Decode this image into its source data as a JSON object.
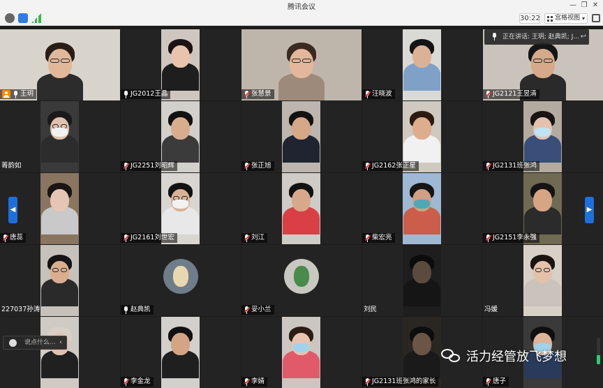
{
  "window": {
    "title": "腾讯会议"
  },
  "toolbar": {
    "icons": [
      "info-icon",
      "shield-icon",
      "signal-icon"
    ],
    "timer": "30:22",
    "view_mode": "宫格视图",
    "fullscreen_icon": "fullscreen-icon"
  },
  "speaking_banner": {
    "text": "正在讲话: 王玥; 赵典凯; J..."
  },
  "chat": {
    "placeholder": "说点什么..."
  },
  "watermark": {
    "text": "活力经管放飞梦想"
  },
  "volume": {
    "level": 0.35
  },
  "participants": [
    {
      "name": "王玥",
      "mic": "on",
      "host": true,
      "kind": "video",
      "bg": "#d8d4cc",
      "skin": "#e2b89a",
      "hair": "#2a1d16",
      "shirt": "#2c2c2c",
      "glasses": true,
      "mask": false
    },
    {
      "name": "JG2012王晶",
      "mic": "on",
      "kind": "video",
      "bg": "#cfc6c0",
      "skin": "#e8c4ad",
      "hair": "#1b1412",
      "shirt": "#1e1e1e",
      "glasses": false,
      "mask": false
    },
    {
      "name": "张慧景",
      "mic": "off",
      "kind": "video",
      "bg": "#bfb6ab",
      "skin": "#e3b79b",
      "hair": "#3a2a20",
      "shirt": "#9e8a7a",
      "glasses": true,
      "mask": false
    },
    {
      "name": "汪晓波",
      "mic": "off",
      "kind": "video",
      "bg": "#d9dad6",
      "skin": "#dcb296",
      "hair": "#141414",
      "shirt": "#7fa1c8",
      "glasses": false,
      "mask": false
    },
    {
      "name": "JG2121王昱清",
      "mic": "off",
      "kind": "video",
      "bg": "#c9c3bb",
      "skin": "#d6a98a",
      "hair": "#151515",
      "shirt": "#2a2a2a",
      "glasses": true,
      "mask": false
    },
    {
      "name": "菁韵如",
      "mic": "none",
      "kind": "video",
      "bg": "#3a3a3a",
      "skin": "#e0c0ae",
      "hair": "#1a1a1a",
      "shirt": "#2c2c2c",
      "glasses": true,
      "mask": true,
      "mask_color": "#f1f1f1"
    },
    {
      "name": "JG2251刘昭辉",
      "mic": "off",
      "kind": "video",
      "bg": "#d2d0cb",
      "skin": "#d8ad8e",
      "hair": "#111111",
      "shirt": "#3b3b3b",
      "glasses": false,
      "mask": false
    },
    {
      "name": "张正旭",
      "mic": "off",
      "kind": "video",
      "bg": "#bcb6ae",
      "skin": "#d6a887",
      "hair": "#121212",
      "shirt": "#1f2430",
      "glasses": false,
      "mask": false
    },
    {
      "name": "JG2162张正星",
      "mic": "off",
      "kind": "video",
      "bg": "#cfc9bf",
      "skin": "#dcae8e",
      "hair": "#2b1a10",
      "shirt": "#f1f1f1",
      "glasses": false,
      "mask": false
    },
    {
      "name": "JG2131班张鸿",
      "mic": "off",
      "kind": "video",
      "bg": "#b3aba0",
      "skin": "#e4c2ad",
      "hair": "#1a1412",
      "shirt": "#3a4e7a",
      "glasses": false,
      "mask": true,
      "mask_color": "#bfe3f2"
    },
    {
      "name": "唐蕊",
      "mic": "off",
      "kind": "video",
      "bg": "#8a7560",
      "skin": "#e5c6b5",
      "hair": "#1a1512",
      "shirt": "#c9c9c9",
      "glasses": false,
      "mask": false
    },
    {
      "name": "JG2161刘世宏",
      "mic": "off",
      "kind": "video",
      "bg": "#d9d6d1",
      "skin": "#d9b296",
      "hair": "#121212",
      "shirt": "#e8e8e8",
      "glasses": true,
      "mask": true,
      "mask_color": "#f2f2f2"
    },
    {
      "name": "刘江",
      "mic": "off",
      "kind": "video",
      "bg": "#cfccc7",
      "skin": "#d7a98a",
      "hair": "#121212",
      "shirt": "#d94046",
      "glasses": false,
      "mask": false
    },
    {
      "name": "柴宏亮",
      "mic": "off",
      "kind": "video",
      "bg": "#9fb9d4",
      "skin": "#cfa084",
      "hair": "#161616",
      "shirt": "#cc5d4b",
      "glasses": false,
      "mask": true,
      "mask_color": "#4fa8b8"
    },
    {
      "name": "JG2151李永强",
      "mic": "off",
      "kind": "video",
      "bg": "#6f6a52",
      "skin": "#d6a583",
      "hair": "#141414",
      "shirt": "#2b2b2b",
      "glasses": false,
      "mask": false
    },
    {
      "name": "227037孙涛",
      "mic": "none",
      "kind": "video",
      "bg": "#c6c1ba",
      "skin": "#d9ae90",
      "hair": "#141414",
      "shirt": "#2a2a2a",
      "glasses": true,
      "mask": false
    },
    {
      "name": "赵典凯",
      "mic": "on",
      "kind": "avatar",
      "avatar_bg": "#6f7c8a",
      "avatar_fg": "#e8d8b0"
    },
    {
      "name": "妥小兰",
      "mic": "off",
      "kind": "avatar",
      "avatar_bg": "#c9c7c2",
      "avatar_fg": "#4a8a4a"
    },
    {
      "name": "刘民",
      "mic": "none",
      "kind": "video",
      "bg": "#1e1e1e",
      "skin": "#5b4a3f",
      "hair": "#0c0c0c",
      "shirt": "#151515",
      "glasses": false,
      "mask": false,
      "dark": true
    },
    {
      "name": "冯媛",
      "mic": "none",
      "kind": "video",
      "bg": "#d6d0c7",
      "skin": "#e4c1aa",
      "hair": "#1a1410",
      "shirt": "#c9c3bb",
      "glasses": true,
      "mask": false
    },
    {
      "name": "",
      "mic": "none",
      "kind": "video",
      "bg": "#cfcac4",
      "skin": "#e0c2b0",
      "hair": "#d8d0c6",
      "shirt": "#202020",
      "glasses": false,
      "mask": false
    },
    {
      "name": "李金龙",
      "mic": "off",
      "kind": "video",
      "bg": "#d2d0cc",
      "skin": "#d3a585",
      "hair": "#111111",
      "shirt": "#1f1f1f",
      "glasses": false,
      "mask": false
    },
    {
      "name": "李婧",
      "mic": "off",
      "kind": "video",
      "bg": "#cbc6bf",
      "skin": "#e6c4b0",
      "hair": "#2b1c14",
      "shirt": "#e05a6a",
      "glasses": false,
      "mask": true,
      "mask_color": "#9fd3ec"
    },
    {
      "name": "JG2131班张鸿的家长",
      "mic": "off",
      "kind": "video",
      "bg": "#2a2622",
      "skin": "#6a5546",
      "hair": "#0d0d0d",
      "shirt": "#1a1a1a",
      "glasses": false,
      "mask": false,
      "dark": true
    },
    {
      "name": "唐子",
      "mic": "off",
      "kind": "video",
      "bg": "#3a3a3a",
      "skin": "#dcb598",
      "hair": "#0f0f0f",
      "shirt": "#2a3a5a",
      "glasses": false,
      "mask": true,
      "mask_color": "#9fd3ec"
    }
  ]
}
